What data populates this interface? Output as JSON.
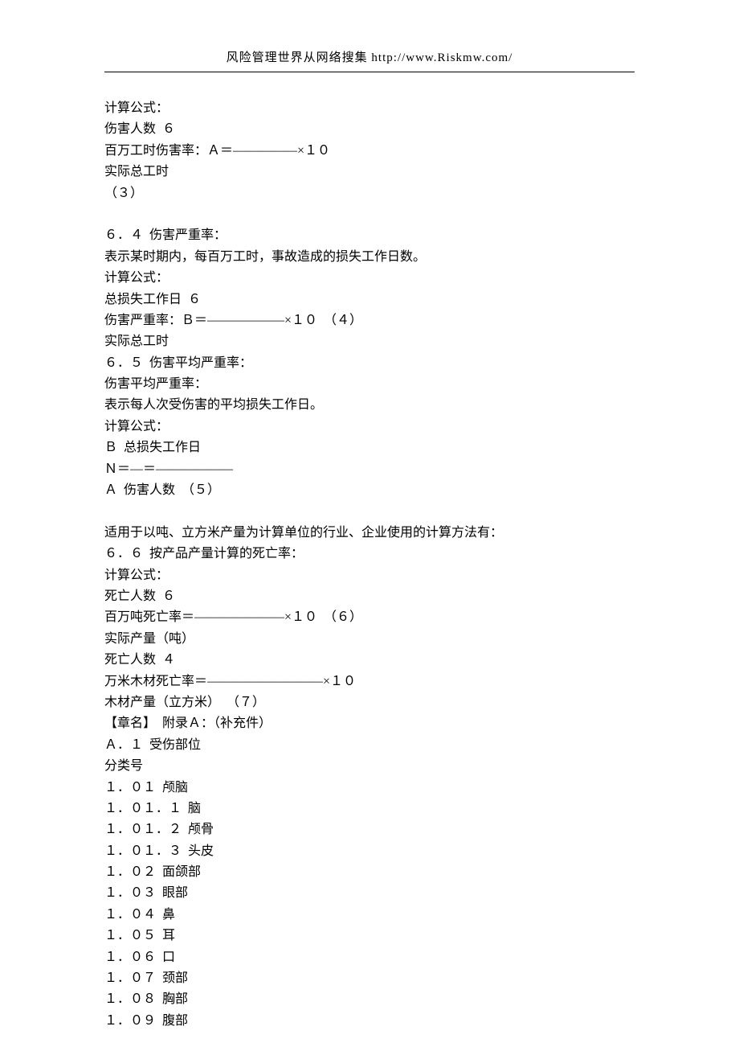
{
  "header": {
    "text": "风险管理世界从网络搜集  http://www.Riskmw.com/"
  },
  "lines": [
    "计算公式：",
    "伤害人数  ６",
    "百万工时伤害率：Ａ＝―――――×１０",
    "实际总工时",
    "（３）",
    "",
    "６．４  伤害严重率：",
    "表示某时期内，每百万工时，事故造成的损失工作日数。",
    "计算公式：",
    "总损失工作日  ６",
    "伤害严重率：Ｂ＝――――――×１０  （４）",
    "实际总工时",
    "６．５  伤害平均严重率：",
    "伤害平均严重率：",
    "表示每人次受伤害的平均损失工作日。",
    "计算公式：",
    "Ｂ  总损失工作日",
    "Ｎ＝―＝――――――",
    "Ａ  伤害人数  （５）",
    "",
    "适用于以吨、立方米产量为计算单位的行业、企业使用的计算方法有：",
    "６．６  按产品产量计算的死亡率：",
    "计算公式：",
    "死亡人数  ６",
    "百万吨死亡率＝―――――――×１０  （６）",
    "实际产量（吨）",
    "死亡人数  ４",
    "万米木材死亡率＝―――――――――×１０",
    "木材产量（立方米）  （７）",
    "【章名】  附录Ａ：（补充件）",
    "Ａ．１  受伤部位",
    "分类号",
    "１．０１  颅脑",
    "１．０１．１  脑",
    "１．０１．２  颅骨",
    "１．０１．３  头皮",
    "１．０２  面颌部",
    "１．０３  眼部",
    "１．０４  鼻",
    "１．０５  耳",
    "１．０６  口",
    "１．０７  颈部",
    "１．０８  胸部",
    "１．０９  腹部"
  ]
}
